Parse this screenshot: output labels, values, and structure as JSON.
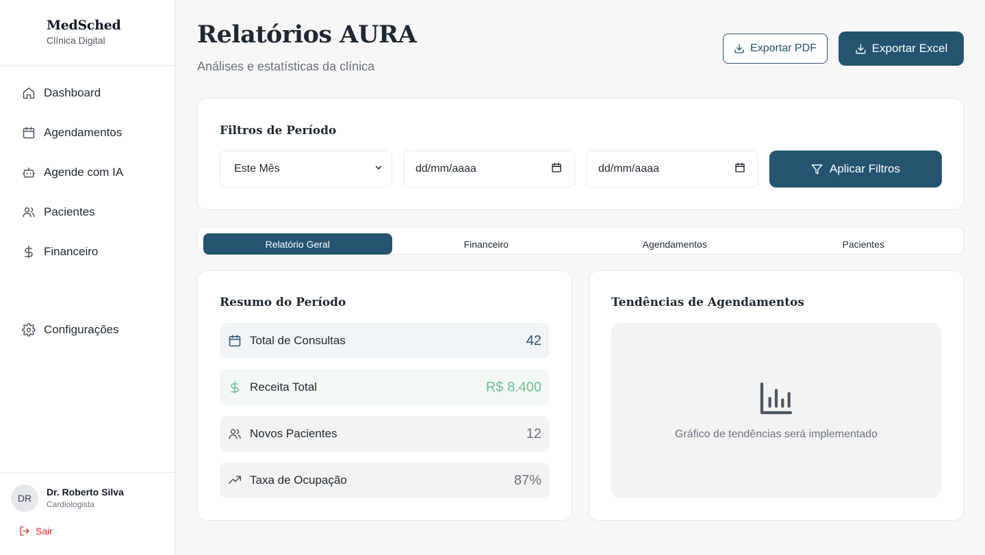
{
  "brand": {
    "name": "MedSched",
    "subtitle": "Clínica Digital"
  },
  "nav": {
    "items": [
      {
        "label": "Dashboard",
        "icon": "home-icon"
      },
      {
        "label": "Agendamentos",
        "icon": "calendar-icon"
      },
      {
        "label": "Agende com IA",
        "icon": "bot-icon"
      },
      {
        "label": "Pacientes",
        "icon": "users-icon"
      },
      {
        "label": "Financeiro",
        "icon": "dollar-icon"
      }
    ],
    "settings": {
      "label": "Configurações",
      "icon": "gear-icon"
    }
  },
  "user": {
    "initials": "DR",
    "name": "Dr. Roberto Silva",
    "role": "Cardiologista",
    "logout_label": "Sair"
  },
  "header": {
    "title": "Relatórios AURA",
    "subtitle": "Análises e estatísticas da clínica",
    "export_pdf_label": "Exportar PDF",
    "export_excel_label": "Exportar Excel"
  },
  "filters": {
    "title": "Filtros de Período",
    "period_selected": "Este Mês",
    "start_date_placeholder": "dd/mm/aaaa",
    "end_date_placeholder": "dd/mm/aaaa",
    "apply_label": "Aplicar Filtros"
  },
  "tabs": [
    {
      "label": "Relatório Geral",
      "active": true
    },
    {
      "label": "Financeiro",
      "active": false
    },
    {
      "label": "Agendamentos",
      "active": false
    },
    {
      "label": "Pacientes",
      "active": false
    }
  ],
  "summary": {
    "title": "Resumo do Período",
    "stats": [
      {
        "label": "Total de Consultas",
        "value": "42",
        "icon": "calendar-icon"
      },
      {
        "label": "Receita Total",
        "value": "R$ 8.400",
        "icon": "dollar-icon"
      },
      {
        "label": "Novos Pacientes",
        "value": "12",
        "icon": "users-icon"
      },
      {
        "label": "Taxa de Ocupação",
        "value": "87%",
        "icon": "trending-up-icon"
      }
    ]
  },
  "trends": {
    "title": "Tendências de Agendamentos",
    "placeholder_text": "Gráfico de tendências será implementado",
    "icon": "bar-chart-icon"
  },
  "colors": {
    "primary": "#24546f",
    "success": "#6cc08e",
    "danger": "#dc2626",
    "muted": "#6b7280"
  }
}
